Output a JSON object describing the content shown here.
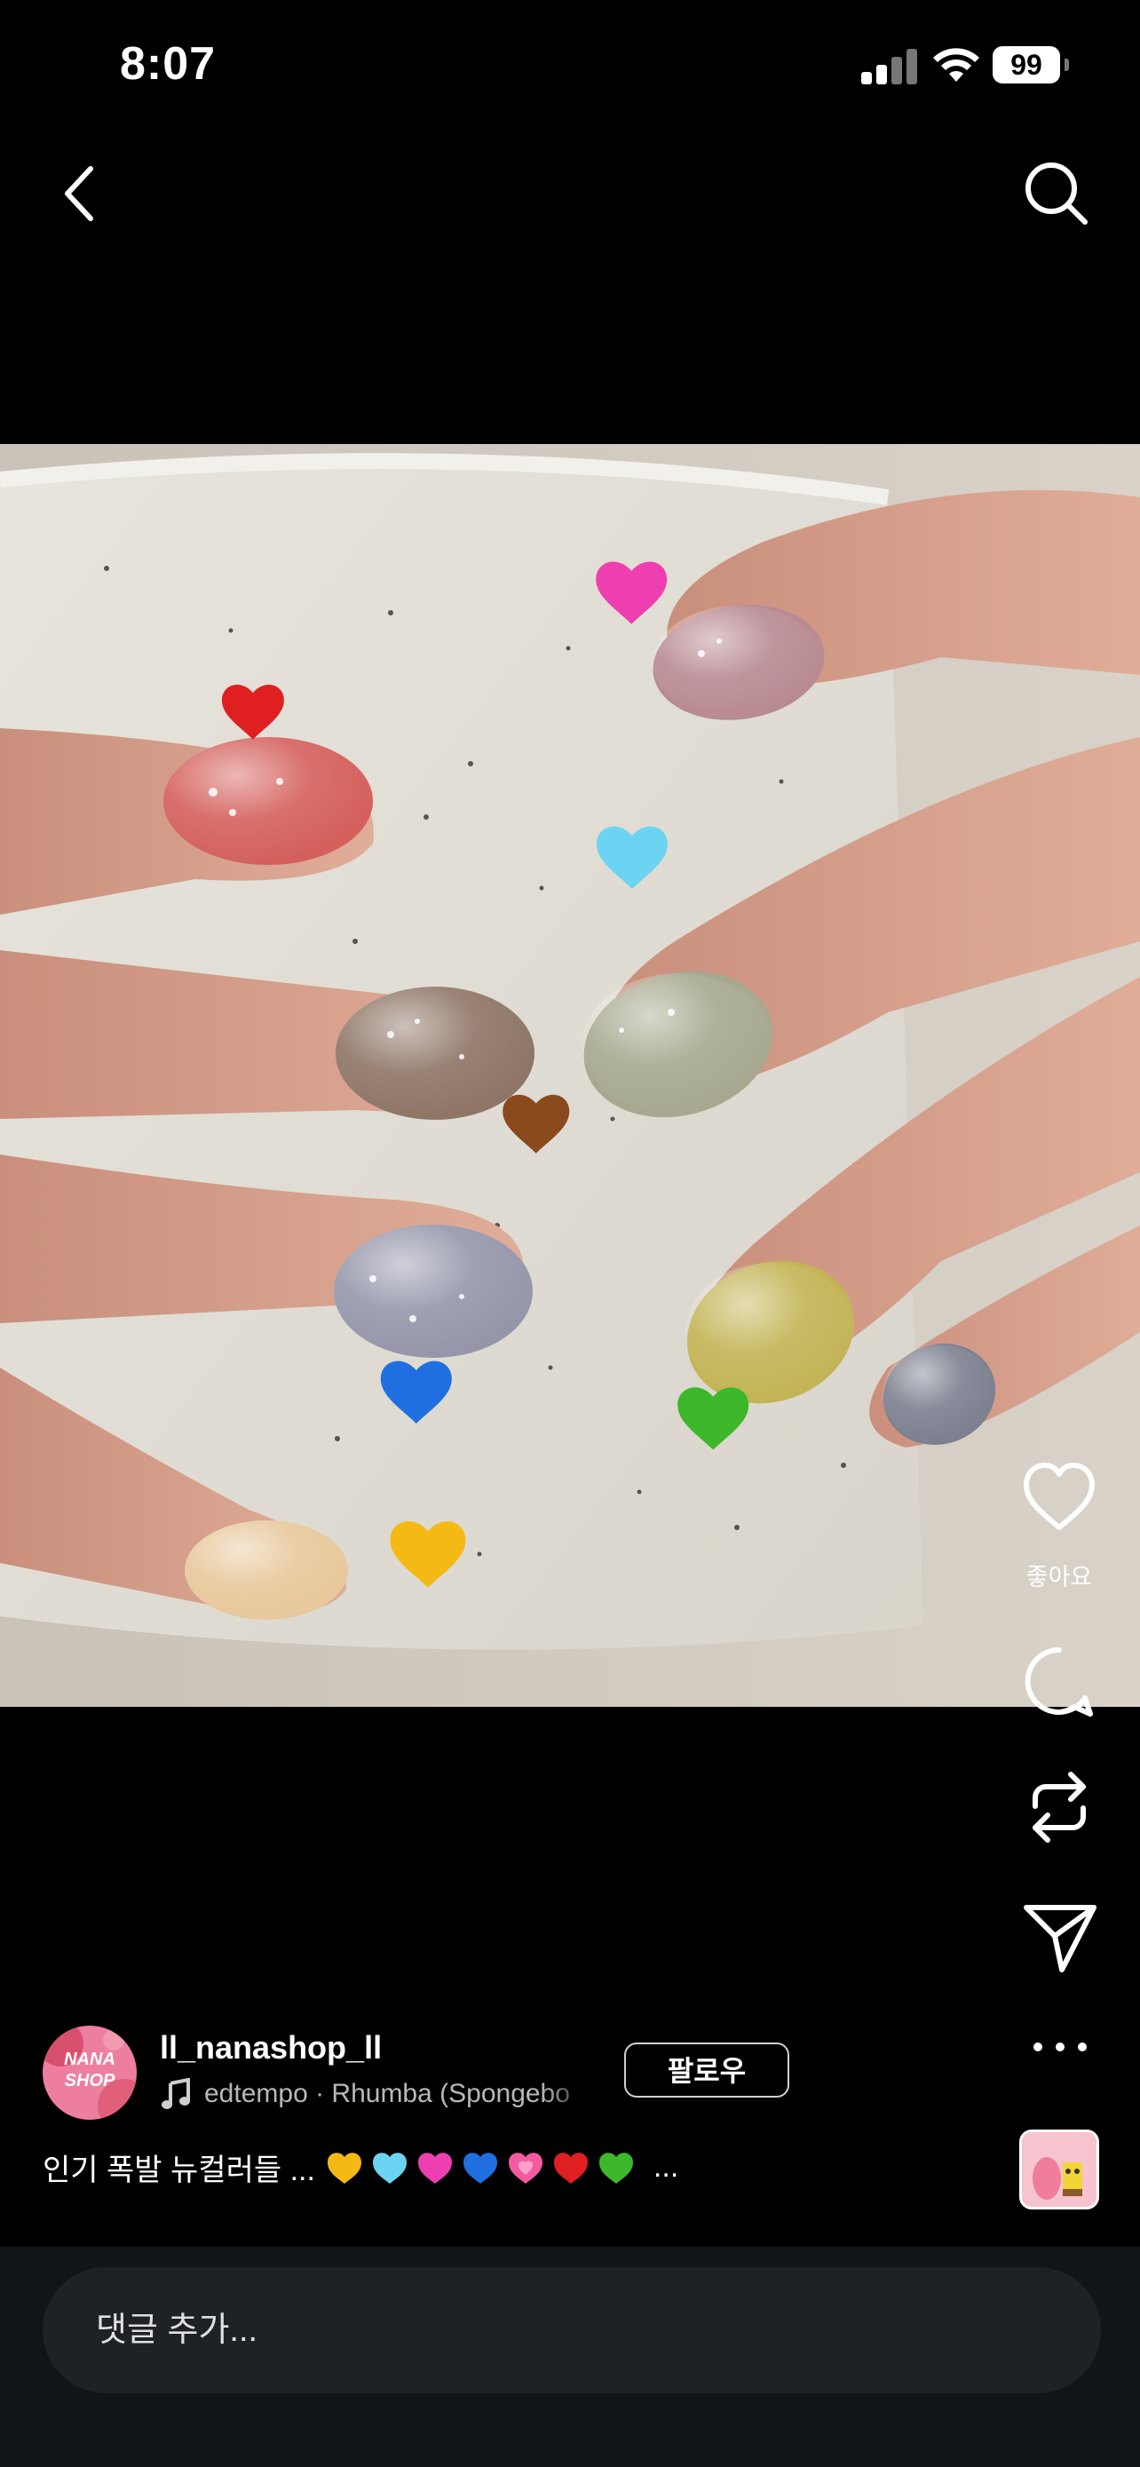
{
  "status_bar": {
    "time": "8:07",
    "battery": "99"
  },
  "nav": {
    "back_icon": "chevron-left-icon",
    "search_icon": "search-icon"
  },
  "post": {
    "image_description_icons": [
      "red-heart",
      "pink-heart",
      "light-blue-heart",
      "brown-heart",
      "blue-heart",
      "green-heart",
      "yellow-heart"
    ]
  },
  "actions": {
    "like_label": "좋아요"
  },
  "account": {
    "avatar_text_line1": "NANA",
    "avatar_text_line2": "SHOP",
    "username": "ll_nanashop_ll",
    "music": "edtempo · Rhumba (Spongebo",
    "follow_label": "팔로우"
  },
  "caption": {
    "text": "인기 폭발 뉴컬러들 ...",
    "more": "..."
  },
  "comment": {
    "placeholder": "댓글 추가..."
  },
  "colors": {
    "background": "#000000",
    "comment_bar": "#111418",
    "input": "#1e2226"
  }
}
